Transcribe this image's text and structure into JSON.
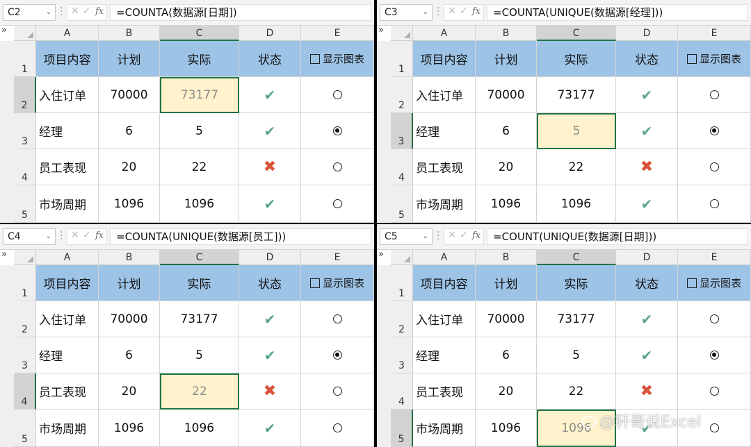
{
  "columns": [
    "A",
    "B",
    "C",
    "D",
    "E"
  ],
  "rows": [
    "1",
    "2",
    "3",
    "4",
    "5"
  ],
  "header": {
    "a": "项目内容",
    "b": "计划",
    "c": "实际",
    "d": "状态",
    "e": "显示图表"
  },
  "data_rows": [
    {
      "name": "入住订单",
      "plan": "70000",
      "actual": "73177",
      "status": "check",
      "radio": "off"
    },
    {
      "name": "经理",
      "plan": "6",
      "actual": "5",
      "status": "check",
      "radio": "on"
    },
    {
      "name": "员工表现",
      "plan": "20",
      "actual": "22",
      "status": "cross",
      "radio": "off"
    },
    {
      "name": "市场周期",
      "plan": "1096",
      "actual": "1096",
      "status": "check",
      "radio": "off"
    }
  ],
  "panes": [
    {
      "cell_ref": "C2",
      "formula": "=COUNTA(数据源[日期])",
      "active_row": 2
    },
    {
      "cell_ref": "C3",
      "formula": "=COUNTA(UNIQUE(数据源[经理]))",
      "active_row": 3
    },
    {
      "cell_ref": "C4",
      "formula": "=COUNTA(UNIQUE(数据源[员工]))",
      "active_row": 4
    },
    {
      "cell_ref": "C5",
      "formula": "=COUNT(UNIQUE(数据源[日期]))",
      "active_row": 5
    }
  ],
  "icons": {
    "status_ok": "check-mark-icon",
    "status_bad": "cross-mark-icon",
    "fx": "fx-icon",
    "expand": "expand-icon"
  },
  "glyphs": {
    "fx": "fx",
    "check": "✔",
    "cross": "✖",
    "cancel": "✕",
    "enter": "✓",
    "expand": "»",
    "dropdown": "⌄"
  },
  "colors": {
    "header_fill": "#9dc3e6",
    "active_fill": "#fff2cc",
    "selection_border": "#217346",
    "check": "#5aa58a",
    "cross": "#d9533a"
  },
  "watermark": "@轩哥说Excel"
}
